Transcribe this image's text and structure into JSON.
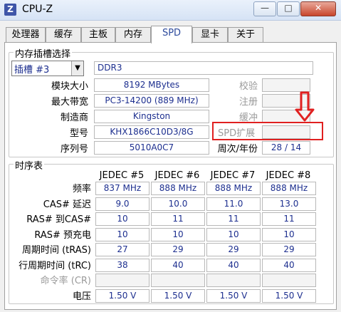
{
  "window": {
    "title": "CPU-Z",
    "icon_letter": "Z",
    "min_label": "—",
    "max_label": "□",
    "close_label": "✕"
  },
  "tabs": [
    "处理器",
    "缓存",
    "主板",
    "内存",
    "SPD",
    "显卡",
    "关于"
  ],
  "active_tab": "SPD",
  "slot_group": {
    "title": "内存插槽选择",
    "slot_select": "插槽 #3",
    "memory_type": "DDR3",
    "labels": {
      "module_size": "模块大小",
      "max_bandwidth": "最大带宽",
      "manufacturer": "制造商",
      "part_number": "型号",
      "serial_number": "序列号"
    },
    "values": {
      "module_size": "8192 MBytes",
      "max_bandwidth": "PC3-14200 (889 MHz)",
      "manufacturer": "Kingston",
      "part_number": "KHX1866C10D3/8G",
      "serial_number": "5010A0C7"
    },
    "right_labels": {
      "correction": "校验",
      "registered": "注册",
      "buffered": "缓冲",
      "spd_ext": "SPD扩展",
      "week_year": "周次/年份"
    },
    "week_year_value": "28 / 14"
  },
  "timings_group": {
    "title": "时序表",
    "columns": [
      "JEDEC #5",
      "JEDEC #6",
      "JEDEC #7",
      "JEDEC #8"
    ],
    "rows": [
      {
        "label": "频率",
        "values": [
          "837 MHz",
          "888 MHz",
          "888 MHz",
          "888 MHz"
        ],
        "dim": false
      },
      {
        "label": "CAS# 延迟",
        "values": [
          "9.0",
          "10.0",
          "11.0",
          "13.0"
        ],
        "dim": false
      },
      {
        "label": "RAS# 到CAS#",
        "values": [
          "10",
          "11",
          "11",
          "11"
        ],
        "dim": false
      },
      {
        "label": "RAS# 预充电",
        "values": [
          "10",
          "10",
          "10",
          "10"
        ],
        "dim": false
      },
      {
        "label": "周期时间 (tRAS)",
        "values": [
          "27",
          "29",
          "29",
          "29"
        ],
        "dim": false
      },
      {
        "label": "行周期时间 (tRC)",
        "values": [
          "38",
          "40",
          "40",
          "40"
        ],
        "dim": false
      },
      {
        "label": "命令率 (CR)",
        "values": [
          "",
          "",
          "",
          ""
        ],
        "dim": true
      },
      {
        "label": "电压",
        "values": [
          "1.50 V",
          "1.50 V",
          "1.50 V",
          "1.50 V"
        ],
        "dim": false
      }
    ]
  },
  "annotation": {
    "color": "#e02020"
  }
}
